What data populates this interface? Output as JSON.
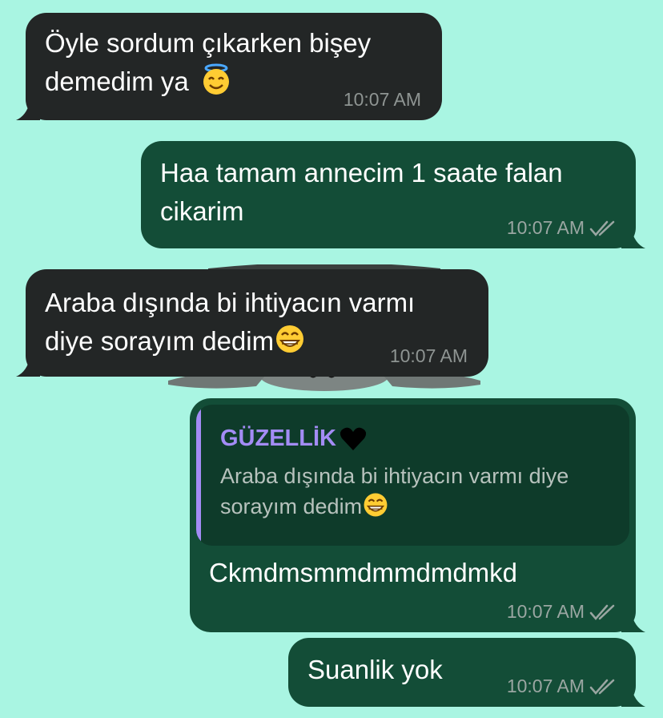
{
  "messages": [
    {
      "id": "m1",
      "direction": "incoming",
      "text": "Öyle sordum çıkarken bişey\ndemedim ya",
      "emoji": "smiling-face-with-halo",
      "time": "10:07 AM"
    },
    {
      "id": "m2",
      "direction": "outgoing",
      "text": "Haa tamam annecim 1 saate falan\ncikarim",
      "time": "10:07 AM",
      "read": true
    },
    {
      "id": "m3",
      "direction": "incoming",
      "text": "Araba dışında bi ihtiyacın varmı\ndiye sorayım dedim",
      "emoji": "grinning-face-with-smiling-eyes",
      "time": "10:07 AM"
    },
    {
      "id": "m4",
      "direction": "outgoing",
      "reply": {
        "sender": "GÜZELLİK",
        "sender_emoji": "black-heart",
        "text": "Araba dışında bi ihtiyacın varmı diye sorayım dedim",
        "emoji": "grinning-face-with-smiling-eyes"
      },
      "text": "Ckmdmsmmdmmdmdmkd",
      "time": "10:07 AM",
      "read": true
    },
    {
      "id": "m5",
      "direction": "outgoing",
      "text": "Suanlik yok",
      "time": "10:07 AM",
      "read": true
    }
  ],
  "colors": {
    "background": "#a9f5e2",
    "incoming_bubble": "#232626",
    "outgoing_bubble": "#134d37",
    "quote_accent": "#a38cf5",
    "timestamp": "#9aa6a2"
  }
}
